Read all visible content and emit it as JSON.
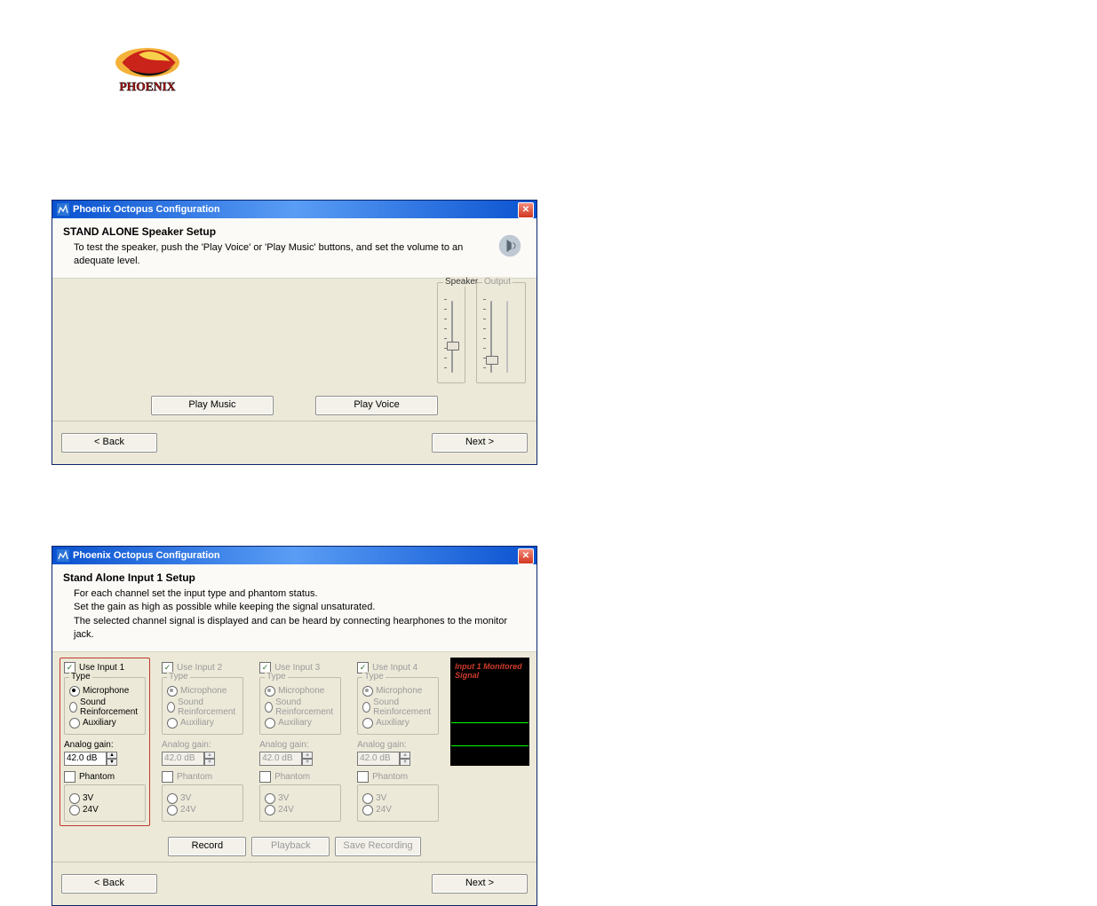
{
  "brand": "PHOENIX",
  "dialog1": {
    "window_title": "Phoenix Octopus Configuration",
    "header_title": "STAND ALONE Speaker Setup",
    "header_sub": "To test the speaker, push the 'Play Voice' or 'Play Music' buttons, and set the volume to an adequate level.",
    "group_speaker": "Speaker",
    "group_output": "Output",
    "btn_play_music": "Play Music",
    "btn_play_voice": "Play Voice",
    "btn_back": "< Back",
    "btn_next": "Next >"
  },
  "dialog2": {
    "window_title": "Phoenix Octopus Configuration",
    "header_title": "Stand Alone Input 1 Setup",
    "header_sub_lines": [
      "For each channel set the input type and phantom status.",
      "Set the gain as high as possible while keeping the signal unsaturated.",
      "The selected channel signal is displayed and can be heard by connecting hearphones to the monitor jack."
    ],
    "channels": [
      {
        "use_label": "Use Input 1",
        "checked": true,
        "enabled": true
      },
      {
        "use_label": "Use Input 2",
        "checked": true,
        "enabled": false
      },
      {
        "use_label": "Use Input 3",
        "checked": true,
        "enabled": false
      },
      {
        "use_label": "Use Input 4",
        "checked": true,
        "enabled": false
      }
    ],
    "type_group": "Type",
    "type_options": [
      "Microphone",
      "Sound Reinforcement",
      "Auxiliary"
    ],
    "type_selected": "Microphone",
    "gain_label": "Analog gain:",
    "gain_value": "42.0 dB",
    "phantom_label": "Phantom",
    "phantom_options": [
      "3V",
      "24V"
    ],
    "scope_label": "Input 1 Monitored Signal",
    "btn_back": "< Back",
    "btn_record": "Record",
    "btn_playback": "Playback",
    "btn_save": "Save Recording",
    "btn_next": "Next >"
  }
}
